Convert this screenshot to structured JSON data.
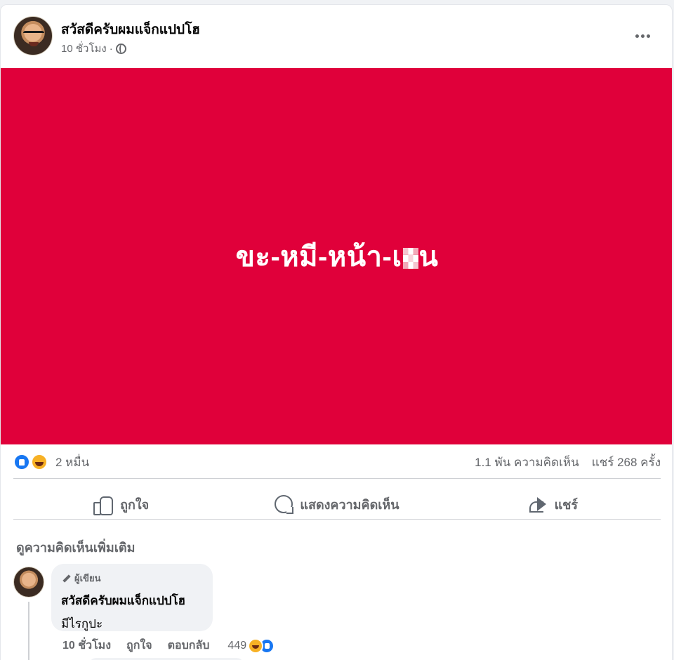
{
  "post": {
    "author": "สวัสดีครับผมแจ็กแปปโฮ",
    "time": "10 ชั่วโมง",
    "separator": "·",
    "media_text_before": "ขะ-หมี-หน้า-เ",
    "media_text_after": "น"
  },
  "stats": {
    "reactions": "2 หมื่น",
    "comments": "1.1 พัน ความคิดเห็น",
    "shares": "แชร์ 268 ครั้ง"
  },
  "actions": {
    "like": "ถูกใจ",
    "comment": "แสดงความคิดเห็น",
    "share": "แชร์"
  },
  "more_comments": "ดูความคิดเห็นเพิ่มเติม",
  "comment": {
    "badge": "ผู้เขียน",
    "author": "สวัสดีครับผมแจ็กแปปโฮ",
    "text": "มีไรกูปะ",
    "time": "10 ชั่วโมง",
    "like": "ถูกใจ",
    "reply": "ตอบกลับ",
    "reaction_count": "449"
  },
  "icons": [
    "globe-icon",
    "more-icon",
    "like-reaction-icon",
    "haha-reaction-icon",
    "thumb-icon",
    "comment-icon",
    "share-icon",
    "pencil-icon"
  ],
  "colors": {
    "media_background": "#e0003a",
    "brand_blue": "#1877f2"
  }
}
